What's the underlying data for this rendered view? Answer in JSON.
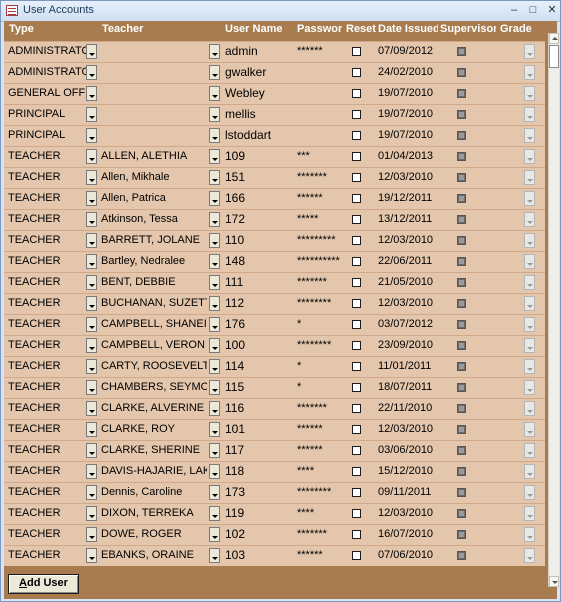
{
  "window": {
    "title": "User Accounts",
    "min_glyph": "–",
    "max_glyph": "□",
    "close_glyph": "✕"
  },
  "columns": {
    "type": "Type",
    "teacher": "Teacher",
    "user_name": "User Name",
    "password": "Password",
    "reset": "Reset",
    "date_issued": "Date Issued",
    "supervisor": "Supervisor",
    "grade": "Grade"
  },
  "rows": [
    {
      "type": "ADMINISTRATOR",
      "teacher": "",
      "user_name": "admin",
      "password": "******",
      "date_issued": "07/09/2012"
    },
    {
      "type": "ADMINISTRATOR",
      "teacher": "",
      "user_name": "gwalker",
      "password": "",
      "date_issued": "24/02/2010"
    },
    {
      "type": "GENERAL OFFICE",
      "teacher": "",
      "user_name": "Webley",
      "password": "",
      "date_issued": "19/07/2010"
    },
    {
      "type": "PRINCIPAL",
      "teacher": "",
      "user_name": "mellis",
      "password": "",
      "date_issued": "19/07/2010"
    },
    {
      "type": "PRINCIPAL",
      "teacher": "",
      "user_name": "lstoddart",
      "password": "",
      "date_issued": "19/07/2010"
    },
    {
      "type": "TEACHER",
      "teacher": "ALLEN, ALETHIA",
      "user_name": "109",
      "password": "***",
      "date_issued": "01/04/2013"
    },
    {
      "type": "TEACHER",
      "teacher": "Allen, Mikhale",
      "user_name": "151",
      "password": "*******",
      "date_issued": "12/03/2010"
    },
    {
      "type": "TEACHER",
      "teacher": "Allen, Patrica",
      "user_name": "166",
      "password": "******",
      "date_issued": "19/12/2011"
    },
    {
      "type": "TEACHER",
      "teacher": "Atkinson, Tessa",
      "user_name": "172",
      "password": "*****",
      "date_issued": "13/12/2011"
    },
    {
      "type": "TEACHER",
      "teacher": "BARRETT, JOLANE",
      "user_name": "110",
      "password": "*********",
      "date_issued": "12/03/2010"
    },
    {
      "type": "TEACHER",
      "teacher": "Bartley, Nedralee",
      "user_name": "148",
      "password": "**********",
      "date_issued": "22/06/2011"
    },
    {
      "type": "TEACHER",
      "teacher": "BENT, DEBBIE",
      "user_name": "111",
      "password": "*******",
      "date_issued": "21/05/2010"
    },
    {
      "type": "TEACHER",
      "teacher": "BUCHANAN, SUZETTE",
      "user_name": "112",
      "password": "********",
      "date_issued": "12/03/2010"
    },
    {
      "type": "TEACHER",
      "teacher": "CAMPBELL, SHANEIKA",
      "user_name": "176",
      "password": "*",
      "date_issued": "03/07/2012"
    },
    {
      "type": "TEACHER",
      "teacher": "CAMPBELL, VERON",
      "user_name": "100",
      "password": "********",
      "date_issued": "23/09/2010"
    },
    {
      "type": "TEACHER",
      "teacher": "CARTY, ROOSEVELT",
      "user_name": "114",
      "password": "*",
      "date_issued": "11/01/2011"
    },
    {
      "type": "TEACHER",
      "teacher": "CHAMBERS, SEYMOUR",
      "user_name": "115",
      "password": "*",
      "date_issued": "18/07/2011"
    },
    {
      "type": "TEACHER",
      "teacher": "CLARKE, ALVERINE",
      "user_name": "116",
      "password": "*******",
      "date_issued": "22/11/2010"
    },
    {
      "type": "TEACHER",
      "teacher": "CLARKE, ROY",
      "user_name": "101",
      "password": "******",
      "date_issued": "12/03/2010"
    },
    {
      "type": "TEACHER",
      "teacher": "CLARKE, SHERINE",
      "user_name": "117",
      "password": "******",
      "date_issued": "03/06/2010"
    },
    {
      "type": "TEACHER",
      "teacher": "DAVIS-HAJARIE, LAKISHA",
      "user_name": "118",
      "password": "****",
      "date_issued": "15/12/2010"
    },
    {
      "type": "TEACHER",
      "teacher": "Dennis, Caroline",
      "user_name": "173",
      "password": "********",
      "date_issued": "09/11/2011"
    },
    {
      "type": "TEACHER",
      "teacher": "DIXON, TERREKA",
      "user_name": "119",
      "password": "****",
      "date_issued": "12/03/2010"
    },
    {
      "type": "TEACHER",
      "teacher": "DOWE, ROGER",
      "user_name": "102",
      "password": "*******",
      "date_issued": "16/07/2010"
    },
    {
      "type": "TEACHER",
      "teacher": "EBANKS, ORAINE",
      "user_name": "103",
      "password": "******",
      "date_issued": "07/06/2010"
    }
  ],
  "footer": {
    "add_user_label": "Add User"
  }
}
